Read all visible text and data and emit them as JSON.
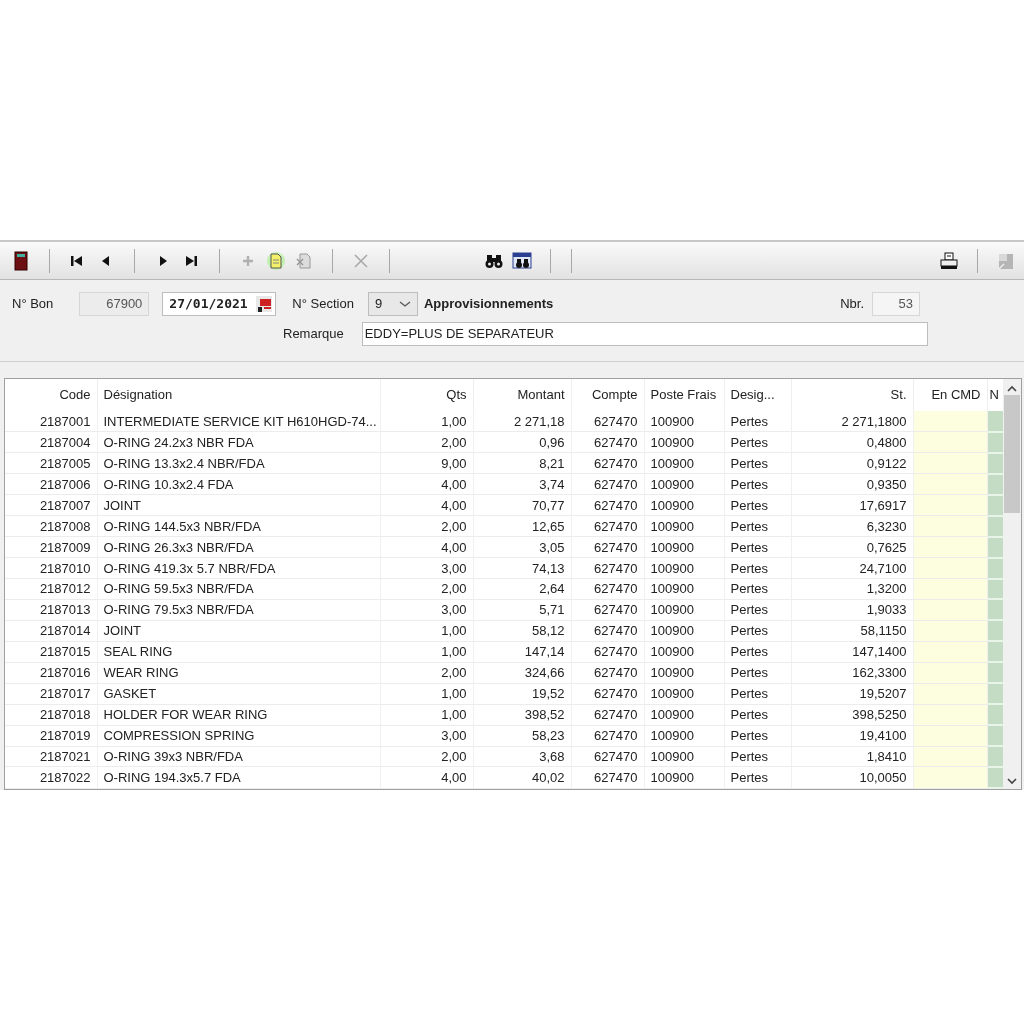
{
  "toolbar": [
    {
      "kind": "exit",
      "disabled": false
    },
    {
      "kind": "first",
      "disabled": false
    },
    {
      "kind": "prev",
      "disabled": false
    },
    {
      "kind": "next",
      "disabled": false
    },
    {
      "kind": "last",
      "disabled": false
    },
    {
      "kind": "add",
      "disabled": true
    },
    {
      "kind": "new",
      "disabled": false
    },
    {
      "kind": "copy",
      "disabled": true
    },
    {
      "kind": "delete",
      "disabled": true
    },
    {
      "kind": "search",
      "disabled": false
    },
    {
      "kind": "search-list",
      "disabled": false
    },
    {
      "kind": "print",
      "disabled": false
    },
    {
      "kind": "export",
      "disabled": true
    }
  ],
  "form": {
    "bon_label": "N° Bon",
    "bon_value": "67900",
    "date": "27/01/2021",
    "section_label": "N° Section",
    "section_value": "9",
    "section_name": "Approvisionnements",
    "nbr_label": "Nbr.",
    "nbr_value": "53",
    "remarque_label": "Remarque",
    "remarque_value": "EDDY=PLUS DE SEPARATEUR"
  },
  "table": {
    "columns": [
      {
        "label": "Code"
      },
      {
        "label": "Désignation"
      },
      {
        "label": "Qts"
      },
      {
        "label": "Montant"
      },
      {
        "label": "Compte"
      },
      {
        "label": "Poste Frais"
      },
      {
        "label": "Desig..."
      },
      {
        "label": "St."
      },
      {
        "label": "En CMD",
        "color": "#fdfde0"
      },
      {
        "label": "N",
        "color": "#c3dcc3"
      }
    ],
    "rows": [
      [
        "2187001",
        "INTERMEDIATE SERVICE KIT H610HGD-74...",
        "1,00",
        "2 271,18",
        "627470",
        "100900",
        "Pertes",
        "2 271,1800"
      ],
      [
        "2187004",
        "O-RING 24.2x3 NBR FDA",
        "2,00",
        "0,96",
        "627470",
        "100900",
        "Pertes",
        "0,4800"
      ],
      [
        "2187005",
        "O-RING 13.3x2.4 NBR/FDA",
        "9,00",
        "8,21",
        "627470",
        "100900",
        "Pertes",
        "0,9122"
      ],
      [
        "2187006",
        "O-RING 10.3x2.4 FDA",
        "4,00",
        "3,74",
        "627470",
        "100900",
        "Pertes",
        "0,9350"
      ],
      [
        "2187007",
        "JOINT",
        "4,00",
        "70,77",
        "627470",
        "100900",
        "Pertes",
        "17,6917"
      ],
      [
        "2187008",
        "O-RING 144.5x3 NBR/FDA",
        "2,00",
        "12,65",
        "627470",
        "100900",
        "Pertes",
        "6,3230"
      ],
      [
        "2187009",
        "O-RING 26.3x3 NBR/FDA",
        "4,00",
        "3,05",
        "627470",
        "100900",
        "Pertes",
        "0,7625"
      ],
      [
        "2187010",
        "O-RING 419.3x 5.7 NBR/FDA",
        "3,00",
        "74,13",
        "627470",
        "100900",
        "Pertes",
        "24,7100"
      ],
      [
        "2187012",
        "O-RING 59.5x3 NBR/FDA",
        "2,00",
        "2,64",
        "627470",
        "100900",
        "Pertes",
        "1,3200"
      ],
      [
        "2187013",
        "O-RING 79.5x3 NBR/FDA",
        "3,00",
        "5,71",
        "627470",
        "100900",
        "Pertes",
        "1,9033"
      ],
      [
        "2187014",
        "JOINT",
        "1,00",
        "58,12",
        "627470",
        "100900",
        "Pertes",
        "58,1150"
      ],
      [
        "2187015",
        "SEAL RING",
        "1,00",
        "147,14",
        "627470",
        "100900",
        "Pertes",
        "147,1400"
      ],
      [
        "2187016",
        "WEAR RING",
        "2,00",
        "324,66",
        "627470",
        "100900",
        "Pertes",
        "162,3300"
      ],
      [
        "2187017",
        "GASKET",
        "1,00",
        "19,52",
        "627470",
        "100900",
        "Pertes",
        "19,5207"
      ],
      [
        "2187018",
        "HOLDER FOR WEAR RING",
        "1,00",
        "398,52",
        "627470",
        "100900",
        "Pertes",
        "398,5250"
      ],
      [
        "2187019",
        "COMPRESSION SPRING",
        "3,00",
        "58,23",
        "627470",
        "100900",
        "Pertes",
        "19,4100"
      ],
      [
        "2187021",
        "O-RING 39x3 NBR/FDA",
        "2,00",
        "3,68",
        "627470",
        "100900",
        "Pertes",
        "1,8410"
      ],
      [
        "2187022",
        "O-RING 194.3x5.7 FDA",
        "4,00",
        "40,02",
        "627470",
        "100900",
        "Pertes",
        "10,0050"
      ]
    ]
  }
}
